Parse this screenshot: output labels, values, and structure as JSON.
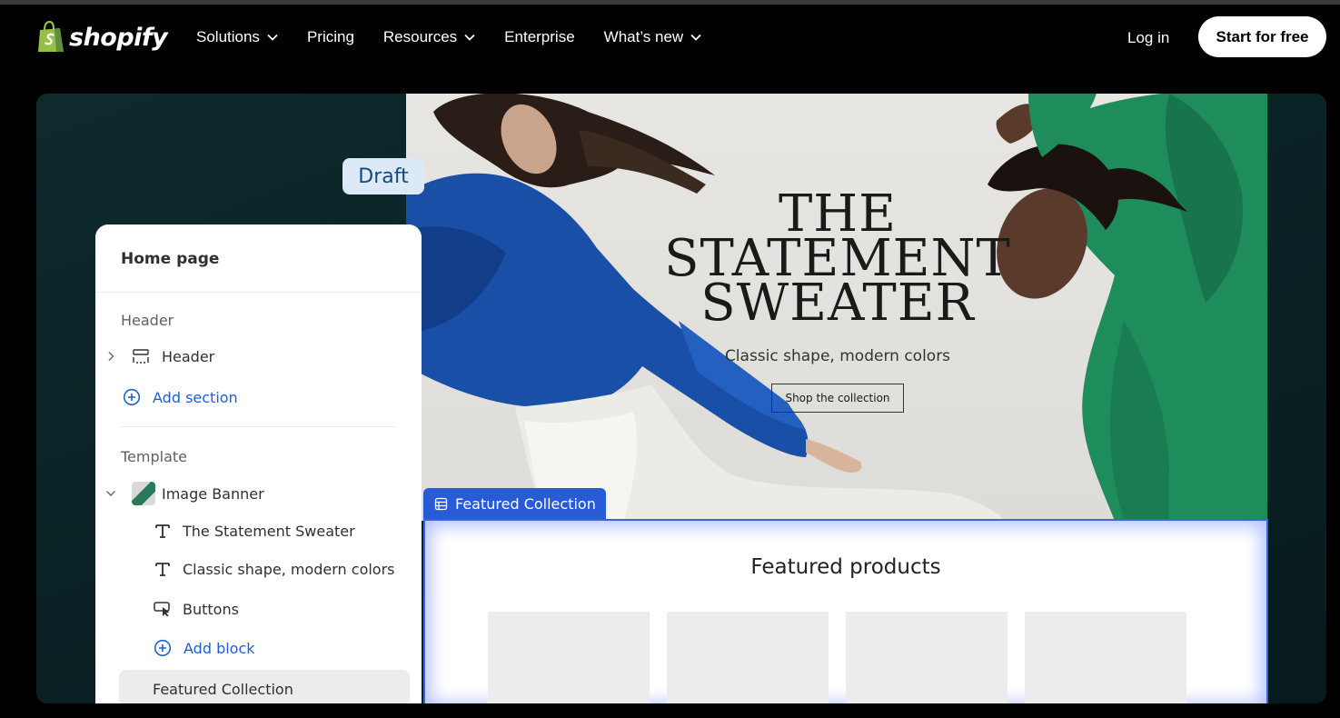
{
  "nav": {
    "logo_text": "shopify",
    "items": [
      {
        "label": "Solutions",
        "has_dropdown": true
      },
      {
        "label": "Pricing",
        "has_dropdown": false
      },
      {
        "label": "Resources",
        "has_dropdown": true
      },
      {
        "label": "Enterprise",
        "has_dropdown": false
      },
      {
        "label": "What’s new",
        "has_dropdown": true
      }
    ],
    "login": "Log in",
    "cta": "Start for free"
  },
  "hero": {
    "draft_badge": "Draft",
    "banner": {
      "title_line1": "THE",
      "title_line2": "STATEMENT",
      "title_line3": "SWEATER",
      "subtitle": "Classic shape, modern colors",
      "button": "Shop the collection"
    },
    "featured": {
      "tag": "Featured Collection",
      "title": "Featured products"
    },
    "editor": {
      "title": "Home page",
      "header_label": "Header",
      "header_item": "Header",
      "add_section": "Add section",
      "template_label": "Template",
      "image_banner": "Image Banner",
      "blocks": [
        {
          "label": "The Statement Sweater",
          "icon": "text-icon"
        },
        {
          "label": "Classic shape, modern colors",
          "icon": "text-icon"
        },
        {
          "label": "Buttons",
          "icon": "cursor-button-icon"
        }
      ],
      "add_block": "Add block",
      "featured_collection": "Featured Collection"
    }
  },
  "colors": {
    "accent_blue": "#2a5bd7",
    "link_blue": "#1f5fd0",
    "panel_bg": "#0a2326",
    "logo_green": "#95bf47"
  }
}
